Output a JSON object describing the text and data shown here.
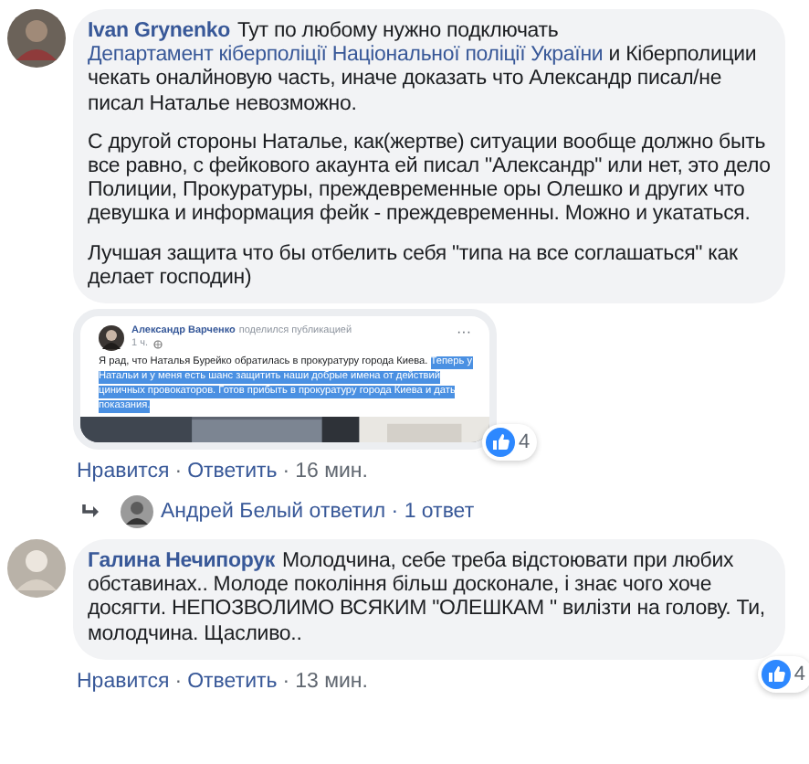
{
  "comments": [
    {
      "author": "Ivan Grynenko",
      "paragraphs": [
        [
          {
            "kind": "text",
            "text": "Тут по любому нужно подключать "
          },
          {
            "kind": "link",
            "text": "Департамент"
          },
          {
            "kind": "link",
            "text": "кіберполіції Національної поліції України"
          },
          {
            "kind": "text",
            "text": " и Кіберполиции чекать оналйновую часть, иначе доказать что Александр писал/не писал Наталье невозможно."
          }
        ],
        [
          {
            "kind": "text",
            "text": "С другой стороны Наталье, как(жертве) ситуации вообще должно быть все равно, с фейкового акаунта ей писал \"Александр\" или нет, это дело Полиции, Прокуратуры, преждевременные оры Олешко и других что девушка и информация фейк - преждевременны. Можно и укататься."
          }
        ],
        [
          {
            "kind": "text",
            "text": "Лучшая защита что бы отбелить себя \"типа на все соглашаться\" как делает господин)"
          }
        ]
      ],
      "attachment": {
        "author": "Александр Варченко",
        "action": "поделился публикацией",
        "time": "1 ч.",
        "more": "···",
        "lines": [
          {
            "text": "Я рад, что Наталья Бурейко обратилась в прокуратуру города Киева.",
            "selected": false
          },
          {
            "text": "Теперь у Натальи и у меня есть шанс защитить наши добрые имена от действий циничных провокаторов. Готов прибыть в прокуратуру города Киева и дать показания.",
            "selected": true
          }
        ]
      },
      "reactions": "4",
      "footer": [
        {
          "kind": "link",
          "text": "Нравится"
        },
        {
          "kind": "sep",
          "text": "·"
        },
        {
          "kind": "link",
          "text": "Ответить"
        },
        {
          "kind": "sep",
          "text": "·"
        },
        {
          "kind": "time",
          "text": "16 мин."
        }
      ],
      "reply_summary": "Андрей Белый ответил · 1 ответ"
    },
    {
      "author": "Галина Нечипорук",
      "paragraphs": [
        [
          {
            "kind": "text",
            "text": "Молодчина, себе треба відстоювати при любих обставинах.. Молоде покоління більш досконале, і знає чого хоче досягти. НЕПОЗВОЛИМО ВСЯКИМ \"ОЛЕШКАМ \" вилізти на голову. Ти, молодчина. Щасливо.."
          }
        ]
      ],
      "reactions": "4",
      "footer": [
        {
          "kind": "link",
          "text": "Нравится"
        },
        {
          "kind": "sep",
          "text": "·"
        },
        {
          "kind": "link",
          "text": "Ответить"
        },
        {
          "kind": "sep",
          "text": "·"
        },
        {
          "kind": "time",
          "text": "13 мин."
        }
      ]
    }
  ]
}
